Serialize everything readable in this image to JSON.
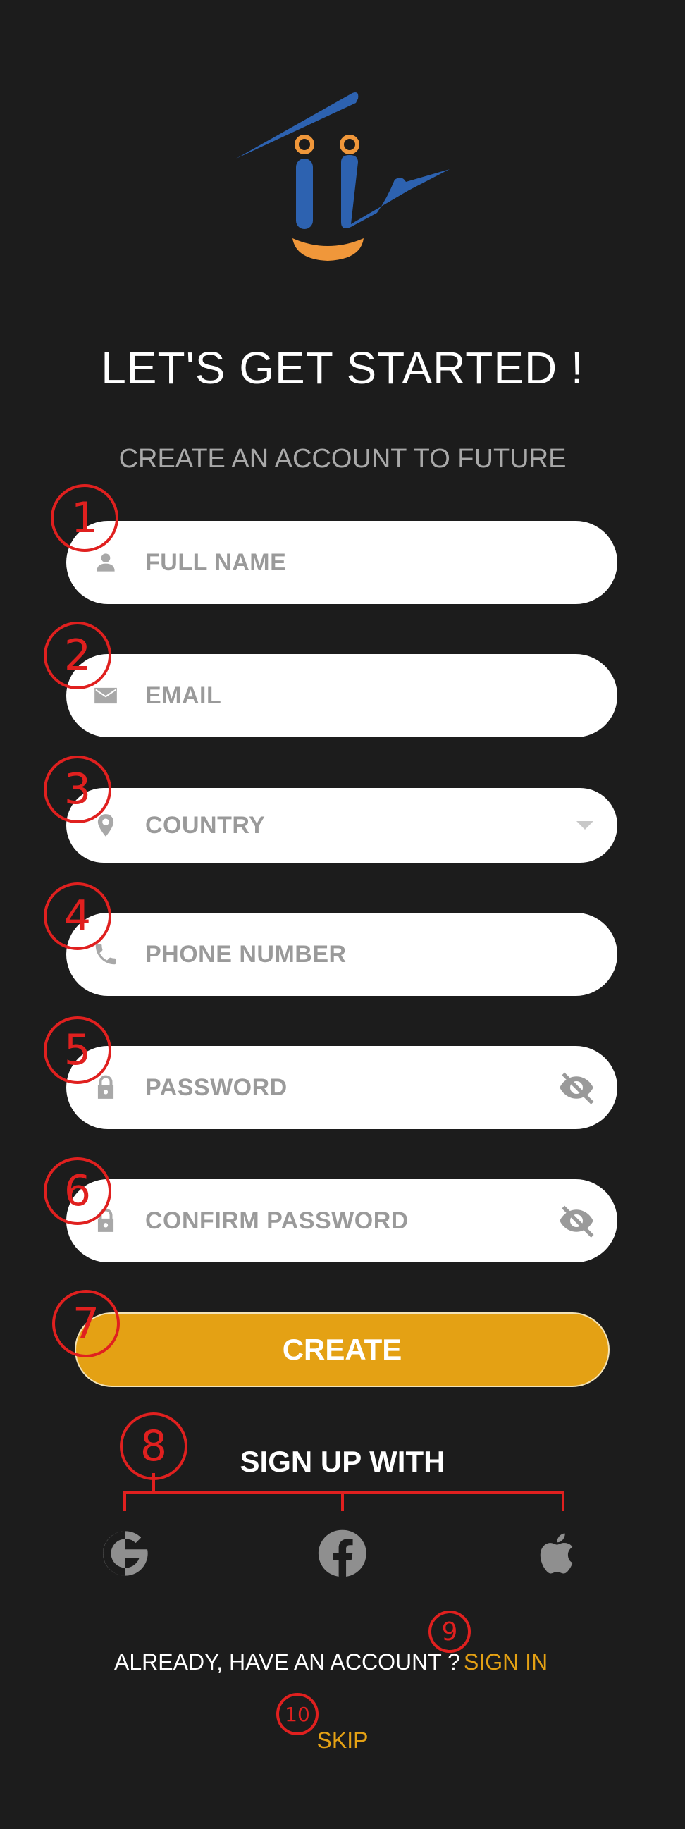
{
  "header": {
    "title": "LET'S GET STARTED !",
    "subtitle": "CREATE AN ACCOUNT TO FUTURE"
  },
  "form": {
    "full_name_placeholder": "FULL NAME",
    "email_placeholder": "EMAIL",
    "country_placeholder": "COUNTRY",
    "phone_placeholder": "PHONE NUMBER",
    "password_placeholder": "PASSWORD",
    "confirm_password_placeholder": "CONFIRM PASSWORD",
    "create_label": "CREATE"
  },
  "social": {
    "heading": "SIGN UP WITH",
    "providers": [
      "google-icon",
      "facebook-icon",
      "apple-icon"
    ]
  },
  "footer": {
    "already_text": "ALREADY, HAVE AN ACCOUNT ?",
    "signin_label": "SIGN IN",
    "skip_label": "SKIP"
  },
  "annotations": [
    "1",
    "2",
    "3",
    "4",
    "5",
    "6",
    "7",
    "8",
    "9",
    "10"
  ],
  "colors": {
    "background": "#1c1c1c",
    "accent": "#e4a114",
    "annotation": "#e0201f",
    "logo_blue": "#2d62b0",
    "logo_orange": "#f0973a"
  }
}
